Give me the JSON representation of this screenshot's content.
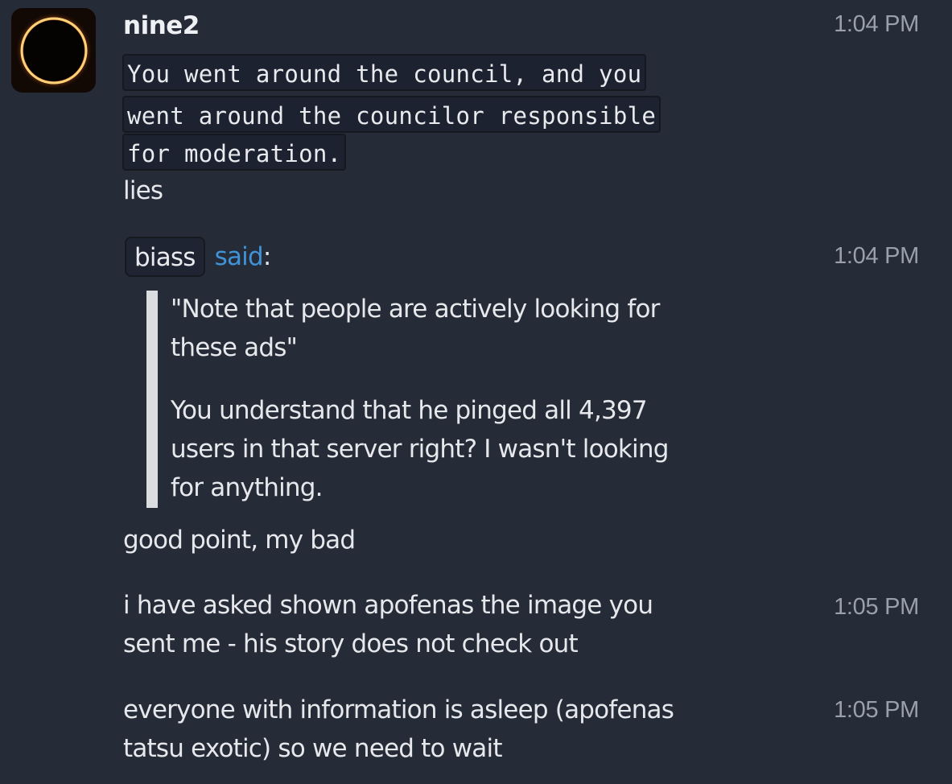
{
  "message": {
    "author": "nine2",
    "time": "1:04 PM",
    "code_lines": [
      "You went around the council, and you",
      "went around the councilor responsible",
      "for moderation."
    ],
    "reply": "lies"
  },
  "quote": {
    "user": "biass",
    "said_label": "said",
    "colon": ":",
    "time": "1:04 PM",
    "paragraph1": [
      "\"Note that people are actively looking for",
      "these ads\""
    ],
    "paragraph2": [
      "You understand that he pinged all 4,397",
      "users in that server right? I wasn't looking",
      "for anything."
    ]
  },
  "followups": [
    {
      "lines": [
        "good point, my bad"
      ],
      "time": ""
    },
    {
      "lines": [
        "i have asked shown apofenas the image you",
        "sent me - his story does not check out"
      ],
      "time": "1:05 PM"
    },
    {
      "lines": [
        "everyone with information is asleep (apofenas",
        "tatsu exotic) so we need to wait"
      ],
      "time": "1:05 PM"
    }
  ],
  "colors": {
    "background": "#262b38",
    "link": "#3f93d6",
    "timestamp": "#9aa0ab",
    "code_background": "#1d2230"
  },
  "avatar": {
    "icon": "solar-eclipse-icon"
  }
}
